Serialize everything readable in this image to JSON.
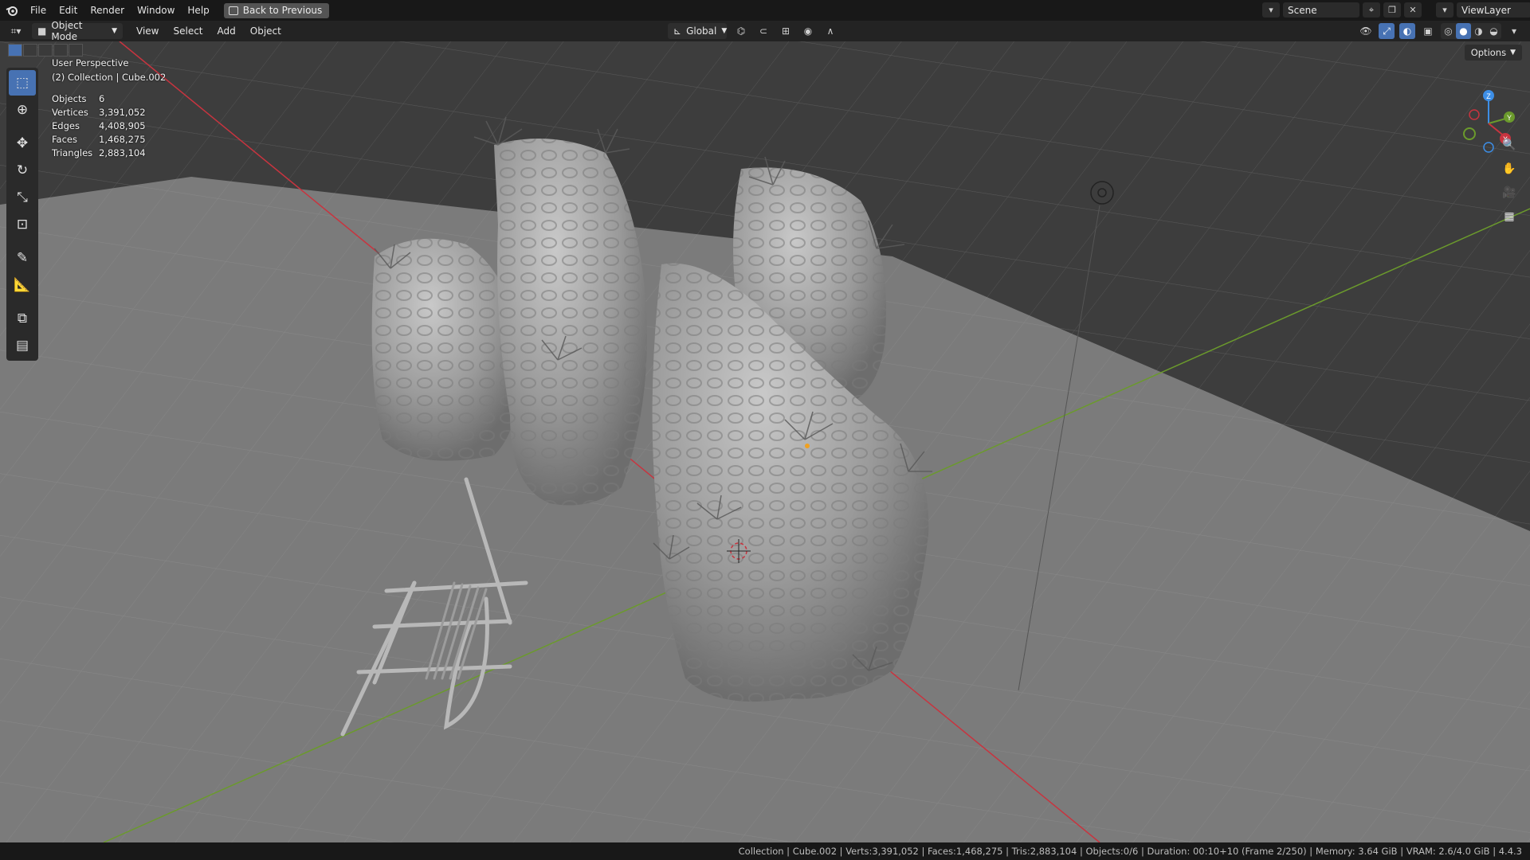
{
  "topbar": {
    "menu": [
      "File",
      "Edit",
      "Render",
      "Window",
      "Help"
    ],
    "back_button": "Back to Previous",
    "scene": "Scene",
    "view_layer": "ViewLayer"
  },
  "viewport_header": {
    "mode": "Object Mode",
    "menu": [
      "View",
      "Select",
      "Add",
      "Object"
    ],
    "orientation": "Global"
  },
  "overlay": {
    "view_name": "User Perspective",
    "collection_line": "(2) Collection | Cube.002",
    "stats": [
      {
        "label": "Objects",
        "value": "6"
      },
      {
        "label": "Vertices",
        "value": "3,391,052"
      },
      {
        "label": "Edges",
        "value": "4,408,905"
      },
      {
        "label": "Faces",
        "value": "1,468,275"
      },
      {
        "label": "Triangles",
        "value": "2,883,104"
      }
    ]
  },
  "options_label": "Options",
  "gizmo": {
    "z": "Z",
    "y": "Y",
    "x": "X"
  },
  "status_bar": "Collection | Cube.002 | Verts:3,391,052 | Faces:1,468,275 | Tris:2,883,104 | Objects:0/6 | Duration: 00:10+10 (Frame 2/250) | Memory: 3.64 GiB | VRAM: 2.6/4.0 GiB | 4.4.3",
  "colors": {
    "accent": "#4772b3",
    "x_axis": "#c8343f",
    "y_axis": "#6b9a2c",
    "z_axis": "#3d8ee6"
  }
}
